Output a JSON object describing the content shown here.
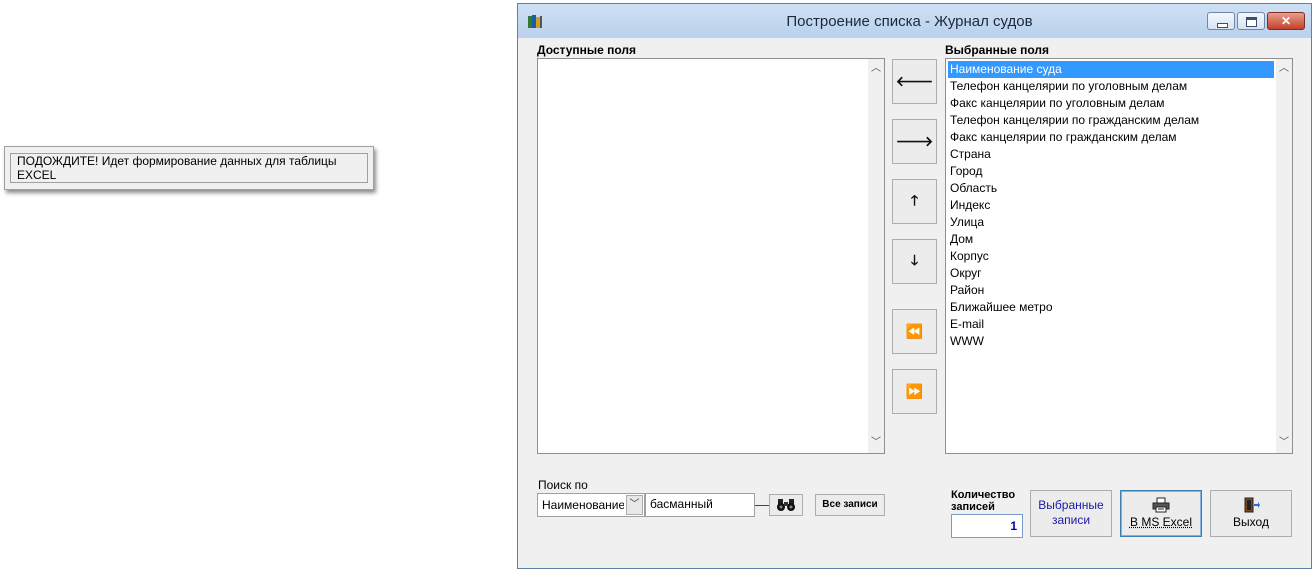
{
  "toast": {
    "message": "ПОДОЖДИТЕ! Идет формирование данных для таблицы EXCEL"
  },
  "window": {
    "title": "Построение списка - Журнал судов",
    "available_label": "Доступные поля",
    "selected_label": "Выбранные поля",
    "available_fields": [],
    "selected_fields": [
      "Наименование суда",
      "Телефон канцелярии по уголовным делам",
      "Факс канцелярии по уголовным делам",
      "Телефон канцелярии по гражданским делам",
      "Факс канцелярии по гражданским делам",
      "Страна",
      "Город",
      "Область",
      "Индекс",
      "Улица",
      "Дом",
      "Корпус",
      "Округ",
      "Район",
      "Ближайшее метро",
      "E-mail",
      "WWW"
    ],
    "selected_index": 0,
    "move_buttons": [
      {
        "name": "move-left-button",
        "glyph": "🡐"
      },
      {
        "name": "move-right-button",
        "glyph": "🡒"
      },
      {
        "name": "move-up-button",
        "glyph": "🡑"
      },
      {
        "name": "move-down-button",
        "glyph": "🡓"
      },
      {
        "name": "move-all-left-button",
        "glyph": "⏪"
      },
      {
        "name": "move-all-right-button",
        "glyph": "⏩"
      }
    ],
    "search": {
      "label": "Поиск по",
      "field_value": "Наименование",
      "query": "басманный",
      "all_records": "Все записи"
    },
    "count": {
      "label_line1": "Количество",
      "label_line2": "записей",
      "value": "1"
    },
    "buttons": {
      "selected_records_line1": "Выбранные",
      "selected_records_line2": "записи",
      "excel": "В MS Excel",
      "exit": "Выход"
    }
  }
}
